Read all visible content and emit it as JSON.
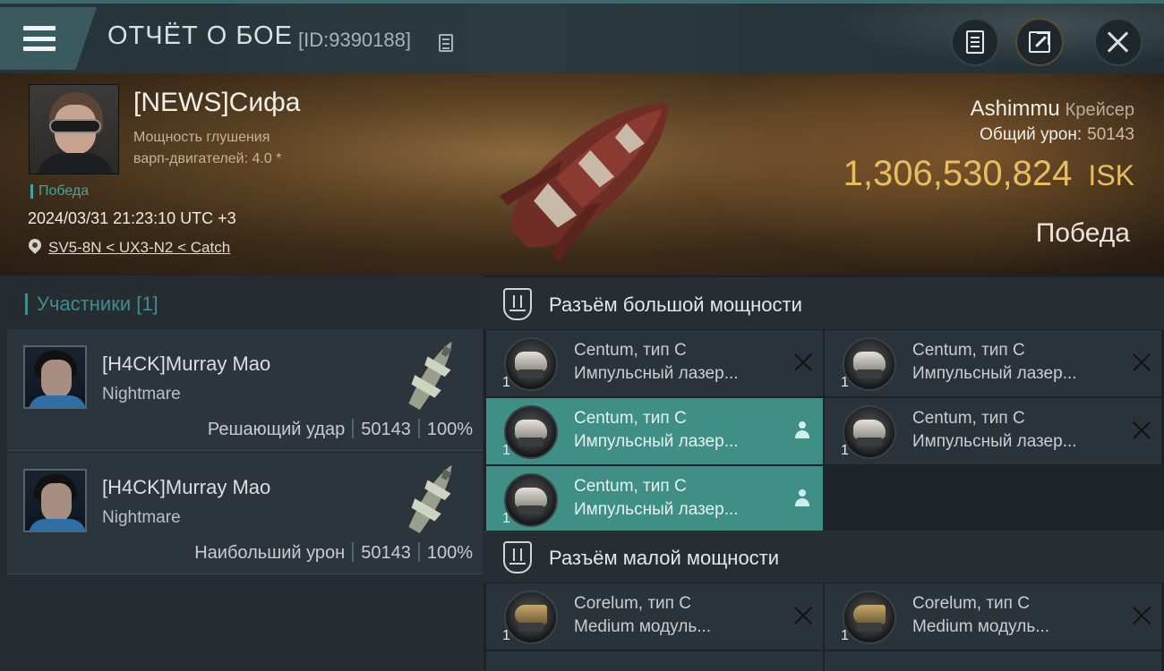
{
  "header": {
    "title": "ОТЧЁТ О БОЕ",
    "report_id": "[ID:9390188]"
  },
  "victim": {
    "pilot_name": "[NEWS]Сифа",
    "stat_line1": "Мощность глушения",
    "stat_line2": "варп-двигателей: 4.0 *",
    "result_tag": "Победа",
    "datetime": "2024/03/31 21:23:10 UTC +3",
    "location": "SV5-8N < UX3-N2 < Catch",
    "ship_name": "Ashimmu",
    "ship_class": "Крейсер",
    "damage_label": "Общий урон:",
    "damage_value": "50143",
    "isk_value": "1,306,530,824",
    "isk_unit": "ISK",
    "result": "Победа"
  },
  "participants": {
    "title": "Участники [1]",
    "items": [
      {
        "name": "[H4CK]Murray Mao",
        "ship": "Nightmare",
        "role": "Решающий удар",
        "damage": "50143",
        "percent": "100%"
      },
      {
        "name": "[H4CK]Murray Mao",
        "ship": "Nightmare",
        "role": "Наибольший урон",
        "damage": "50143",
        "percent": "100%"
      }
    ]
  },
  "fitting": {
    "high_title": "Разъём большой мощности",
    "low_title": "Разъём малой мощности",
    "high_modules": [
      {
        "qty": "1",
        "name": "Centum, тип C",
        "type": "Импульсный лазер...",
        "state": "destroyed"
      },
      {
        "qty": "1",
        "name": "Centum, тип C",
        "type": "Импульсный лазер...",
        "state": "destroyed"
      },
      {
        "qty": "1",
        "name": "Centum, тип C",
        "type": "Импульсный лазер...",
        "state": "dropped"
      },
      {
        "qty": "1",
        "name": "Centum, тип C",
        "type": "Импульсный лазер...",
        "state": "destroyed"
      },
      {
        "qty": "1",
        "name": "Centum, тип C",
        "type": "Импульсный лазер...",
        "state": "dropped"
      }
    ],
    "low_modules": [
      {
        "qty": "1",
        "name": "Corelum, тип C",
        "type": "Medium модуль...",
        "state": "destroyed"
      },
      {
        "qty": "1",
        "name": "Corelum, тип C",
        "type": "Medium модуль...",
        "state": "destroyed"
      }
    ]
  },
  "colors": {
    "accent_teal": "#3f8f86",
    "isk_gold": "#e8bd60",
    "victory_green": "#3ba7a0"
  }
}
